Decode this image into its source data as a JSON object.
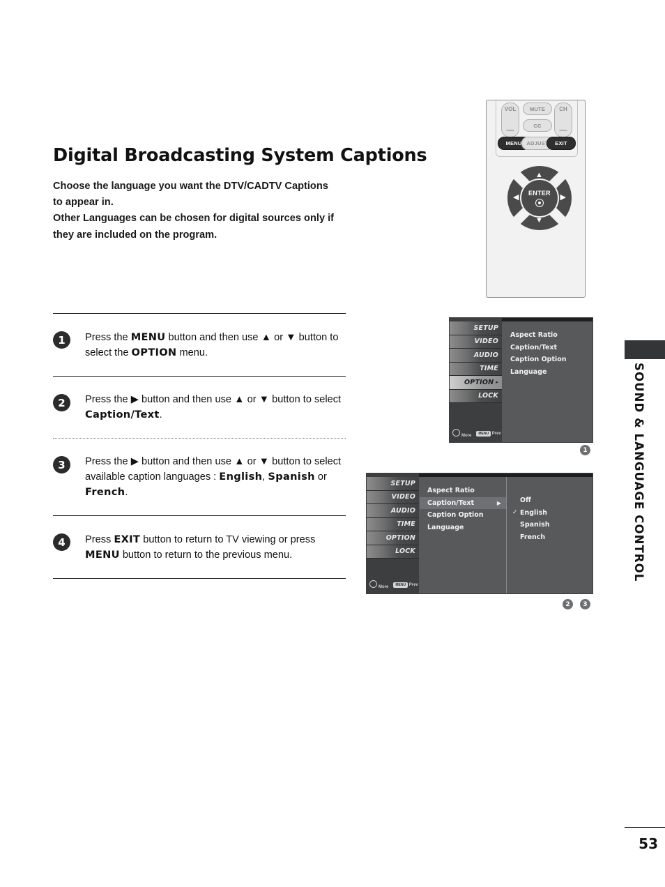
{
  "page": {
    "title": "Digital Broadcasting System Captions",
    "number": "53",
    "side_tab": "SOUND & LANGUAGE CONTROL"
  },
  "intro": {
    "line1": "Choose the language you want the DTV/CADTV Captions",
    "line2": "to appear in.",
    "line3": "Other Languages can be chosen for digital sources only if",
    "line4": "they are included on the program."
  },
  "steps": [
    {
      "badge": "1",
      "segments": [
        {
          "t": "Press the ",
          "b": false
        },
        {
          "t": "MENU",
          "b": true
        },
        {
          "t": " button and then use ",
          "b": false
        },
        {
          "t": "▲",
          "b": false
        },
        {
          "t": " or ",
          "b": false
        },
        {
          "t": "▼",
          "b": false
        },
        {
          "t": "  button to select the ",
          "b": false
        },
        {
          "t": "OPTION",
          "b": true
        },
        {
          "t": " menu.",
          "b": false
        }
      ]
    },
    {
      "badge": "2",
      "segments": [
        {
          "t": "Press the ",
          "b": false
        },
        {
          "t": "▶",
          "b": false
        },
        {
          "t": " button and then use ",
          "b": false
        },
        {
          "t": "▲",
          "b": false
        },
        {
          "t": " or ",
          "b": false
        },
        {
          "t": "▼",
          "b": false
        },
        {
          "t": " button to select ",
          "b": false
        },
        {
          "t": "Caption/Text",
          "b": true
        },
        {
          "t": ".",
          "b": false
        }
      ]
    },
    {
      "badge": "3",
      "segments": [
        {
          "t": "Press the ",
          "b": false
        },
        {
          "t": "▶",
          "b": false
        },
        {
          "t": " button and then use ",
          "b": false
        },
        {
          "t": "▲",
          "b": false
        },
        {
          "t": " or ",
          "b": false
        },
        {
          "t": "▼",
          "b": false
        },
        {
          "t": " button to select available caption languages : ",
          "b": false
        },
        {
          "t": "English",
          "b": true
        },
        {
          "t": ", ",
          "b": false
        },
        {
          "t": "Spanish",
          "b": true
        },
        {
          "t": " or ",
          "b": false
        },
        {
          "t": "French",
          "b": true
        },
        {
          "t": ".",
          "b": false
        }
      ]
    },
    {
      "badge": "4",
      "segments": [
        {
          "t": "Press ",
          "b": false
        },
        {
          "t": "EXIT",
          "b": true
        },
        {
          "t": " button to return to TV viewing or press ",
          "b": false
        },
        {
          "t": "MENU",
          "b": true
        },
        {
          "t": " button to return to the previous menu.",
          "b": false
        }
      ]
    }
  ],
  "remote": {
    "vol_label": "VOL",
    "vol_minus": "—",
    "ch_label": "CH",
    "ch_minus": "—",
    "mute": "MUTE",
    "cc": "CC",
    "menu": "MENU",
    "adjust": "ADJUST",
    "exit": "EXIT",
    "enter": "ENTER",
    "nav_up": "▲",
    "nav_down": "▼",
    "nav_left": "◀",
    "nav_right": "▶"
  },
  "osd1": {
    "marker": "1",
    "side_items": [
      {
        "label": "SETUP",
        "active": false,
        "caret": ""
      },
      {
        "label": "VIDEO",
        "active": false,
        "caret": ""
      },
      {
        "label": "AUDIO",
        "active": false,
        "caret": ""
      },
      {
        "label": "TIME",
        "active": false,
        "caret": ""
      },
      {
        "label": "OPTION",
        "active": true,
        "caret": "▸"
      },
      {
        "label": "LOCK",
        "active": false,
        "caret": ""
      }
    ],
    "foot_more": "More",
    "foot_prev": "Prev",
    "rows": [
      {
        "label": "Aspect Ratio",
        "selected": false,
        "caret": ""
      },
      {
        "label": "Caption/Text",
        "selected": false,
        "caret": ""
      },
      {
        "label": "Caption Option",
        "selected": false,
        "caret": ""
      },
      {
        "label": "Language",
        "selected": false,
        "caret": ""
      }
    ]
  },
  "osd2": {
    "marker_a": "2",
    "marker_b": "3",
    "side_items": [
      {
        "label": "SETUP",
        "active": false,
        "caret": ""
      },
      {
        "label": "VIDEO",
        "active": false,
        "caret": ""
      },
      {
        "label": "AUDIO",
        "active": false,
        "caret": ""
      },
      {
        "label": "TIME",
        "active": false,
        "caret": ""
      },
      {
        "label": "OPTION",
        "active": false,
        "caret": ""
      },
      {
        "label": "LOCK",
        "active": false,
        "caret": ""
      }
    ],
    "foot_more": "More",
    "foot_prev": "Prev",
    "rows": [
      {
        "label": "Aspect Ratio",
        "selected": false,
        "caret": ""
      },
      {
        "label": "Caption/Text",
        "selected": true,
        "caret": "▶"
      },
      {
        "label": "Caption Option",
        "selected": false,
        "caret": ""
      },
      {
        "label": "Language",
        "selected": false,
        "caret": ""
      }
    ],
    "submenu": [
      {
        "label": "Off",
        "checked": false
      },
      {
        "label": "English",
        "checked": true
      },
      {
        "label": "Spanish",
        "checked": false
      },
      {
        "label": "French",
        "checked": false
      }
    ],
    "check_glyph": "✓"
  }
}
